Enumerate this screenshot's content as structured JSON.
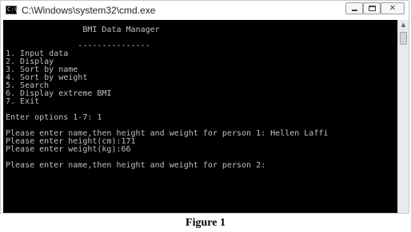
{
  "window": {
    "title": "C:\\Windows\\system32\\cmd.exe",
    "icon": "cmd-icon",
    "buttons": {
      "minimize_icon": "minimize-icon",
      "maximize_icon": "maximize-icon",
      "close_glyph": "✕"
    }
  },
  "console": {
    "background": "#000000",
    "foreground": "#c0c0c0",
    "lines": [
      "                BMI Data Manager",
      "",
      "               ---------------",
      "1. Input data",
      "2. Display",
      "3. Sort by name",
      "4. Sort by weight",
      "5. Search",
      "6. Display extreme BMI",
      "7. Exit",
      "",
      "Enter options 1-7: 1",
      "",
      "Please enter name,then height and weight for person 1: Hellen Laffi",
      "Please enter height(cm):171",
      "Please enter weight(kg):66",
      "",
      "Please enter name,then height and weight for person 2:"
    ]
  },
  "caption": "Figure 1"
}
